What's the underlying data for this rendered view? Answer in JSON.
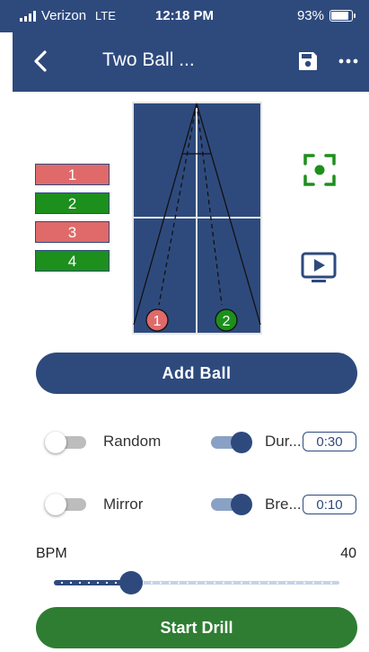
{
  "status_bar": {
    "carrier": "Verizon",
    "network": "LTE",
    "time": "12:18 PM",
    "battery": "93%",
    "battery_level": 0.93
  },
  "nav": {
    "back_icon": "chevron-left-icon",
    "title": "Two Ball ...",
    "save_icon": "save-icon",
    "more_icon": "more-horizontal-icon"
  },
  "court": {
    "surface_color": "#2e4a7d",
    "balls": [
      {
        "label": "1",
        "color": "#e06a6a"
      },
      {
        "label": "2",
        "color": "#1d8f1d"
      }
    ]
  },
  "legend": [
    {
      "label": "1",
      "color": "#e06a6a"
    },
    {
      "label": "2",
      "color": "#1d8f1d"
    },
    {
      "label": "3",
      "color": "#e06a6a"
    },
    {
      "label": "4",
      "color": "#1d8f1d"
    }
  ],
  "side_buttons": {
    "focus_icon": "focus-target-icon",
    "focus_color": "#1d8f1d",
    "play_icon": "screen-play-icon"
  },
  "add_ball_label": "Add Ball",
  "options": {
    "random": {
      "label": "Random",
      "on": false
    },
    "duration": {
      "label": "Dur...",
      "on": true,
      "value": "0:30"
    },
    "mirror": {
      "label": "Mirror",
      "on": false
    },
    "break": {
      "label": "Bre...",
      "on": true,
      "value": "0:10"
    }
  },
  "bpm": {
    "label": "BPM",
    "value": "40",
    "level": 0.27
  },
  "start_label": "Start Drill",
  "colors": {
    "primary": "#2e4a7d",
    "success": "#2e7d32",
    "red_ball": "#e06a6a",
    "green_ball": "#1d8f1d"
  }
}
